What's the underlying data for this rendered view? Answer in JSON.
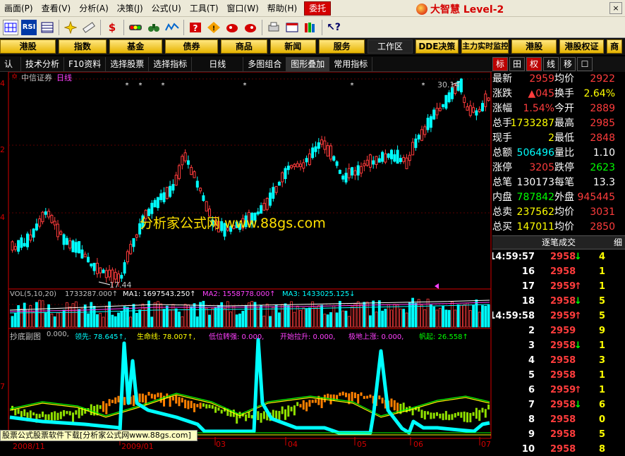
{
  "menubar": {
    "items": [
      "画面(P)",
      "查看(V)",
      "分析(A)",
      "决策(J)",
      "公式(U)",
      "工具(T)",
      "窗口(W)",
      "帮助(H)"
    ],
    "highlight": "委托",
    "brand": "大智慧 Level-2",
    "close": "×"
  },
  "toolbar": {
    "buttons": [
      "rsi",
      "grid",
      "cross",
      "ruler",
      "dollar",
      "traffic-light",
      "binocular",
      "wave",
      "question",
      "signal",
      "flame",
      "target",
      "print",
      "card",
      "books",
      "help-arrow"
    ]
  },
  "quickbar": {
    "left": [
      "港股",
      "指数",
      "基金",
      "债券",
      "商品",
      "新闻",
      "服务"
    ],
    "workspace": "工作区",
    "right": [
      "DDE决策",
      "主力实时监控",
      "港股",
      "港股权证",
      "商"
    ]
  },
  "subbar": {
    "items": [
      "认",
      "技术分析",
      "F10资料",
      "选择股票",
      "选择指标",
      "日线",
      "多图组合",
      "图形叠加",
      "常用指标"
    ]
  },
  "chart": {
    "stock": "中信证券",
    "period": "日线",
    "watermark": "分析家公式网 www.88gs.com",
    "low_label": "17.44",
    "high_label": "30.14",
    "price_axis": [
      "4",
      "2",
      "4"
    ],
    "vol_label": "VOL(5,10,20)",
    "vol_value": "1733287.000↑",
    "ma1": "MA1: 1697543.250↑",
    "ma2": "MA2: 1558778.000↑",
    "ma3": "MA3: 1433025.125↓",
    "ind_title": "抄底副图",
    "ind_val": "0.000,",
    "ind_lead": "领先: 78.645↑,",
    "ind_life": "生命线: 78.007↑,",
    "ind_low": "低位转强: 0.000,",
    "ind_pull": "开始拉升: 0.000,",
    "ind_bottom": "极地上涨: 0.000,",
    "ind_sail": "帆起: 26.558↑",
    "ind_axis": "7",
    "dates": [
      "2008/11",
      "2009/01",
      "03",
      "04",
      "05",
      "06",
      "07"
    ],
    "bottom_note": "股票公式股票软件下载[分析家公式网www.88gs.com]"
  },
  "right_tabs": [
    "标",
    "田",
    "权",
    "线",
    "移",
    "☐"
  ],
  "quote": {
    "rows": [
      {
        "l1": "最新",
        "v1": "2959",
        "l2": "均价",
        "v2": "2922",
        "c1": "#ff3c3c",
        "c2": "#ff3c3c"
      },
      {
        "l1": "涨跌",
        "v1": "▲045",
        "l2": "换手",
        "v2": "2.64%",
        "c1": "#ff3c3c",
        "c2": "#ffff00"
      },
      {
        "l1": "涨幅",
        "v1": "1.54%",
        "l2": "今开",
        "v2": "2889",
        "c1": "#ff3c3c",
        "c2": "#ff3c3c"
      },
      {
        "l1": "总手",
        "v1": "1733287",
        "l2": "最高",
        "v2": "2985",
        "c1": "#ffff00",
        "c2": "#ff3c3c"
      },
      {
        "l1": "现手",
        "v1": "2",
        "l2": "最低",
        "v2": "2848",
        "c1": "#ffff00",
        "c2": "#ff3c3c"
      },
      {
        "l1": "总额",
        "v1": "506496",
        "l2": "量比",
        "v2": "1.10",
        "c1": "#00ffff",
        "c2": "#ffffff"
      },
      {
        "l1": "涨停",
        "v1": "3205",
        "l2": "跌停",
        "v2": "2623",
        "c1": "#ff3c3c",
        "c2": "#00ff00"
      },
      {
        "l1": "总笔",
        "v1": "130173",
        "l2": "每笔",
        "v2": "13.3",
        "c1": "#ffffff",
        "c2": "#ffffff"
      },
      {
        "l1": "内盘",
        "v1": "787842",
        "l2": "外盘",
        "v2": "945445",
        "c1": "#00ff00",
        "c2": "#ff3c3c"
      },
      {
        "l1": "总卖",
        "v1": "237562",
        "l2": "均价",
        "v2": "3031",
        "c1": "#ffff00",
        "c2": "#ff3c3c"
      },
      {
        "l1": "总买",
        "v1": "147011",
        "l2": "均价",
        "v2": "2850",
        "c1": "#ffff00",
        "c2": "#ff3c3c"
      }
    ]
  },
  "ticks": {
    "title": "逐笔成交",
    "side": "细",
    "rows": [
      {
        "t": "14:59:57",
        "p": "2958",
        "d": "down",
        "v": "4"
      },
      {
        "t": "16",
        "p": "2958",
        "d": "",
        "v": "1"
      },
      {
        "t": "17",
        "p": "2959",
        "d": "up",
        "v": "1"
      },
      {
        "t": "18",
        "p": "2958",
        "d": "down",
        "v": "5"
      },
      {
        "t": "14:59:58",
        "p": "2959",
        "d": "up",
        "v": "5"
      },
      {
        "t": "2",
        "p": "2959",
        "d": "",
        "v": "9"
      },
      {
        "t": "3",
        "p": "2958",
        "d": "down",
        "v": "1"
      },
      {
        "t": "4",
        "p": "2958",
        "d": "",
        "v": "3"
      },
      {
        "t": "5",
        "p": "2958",
        "d": "",
        "v": "1"
      },
      {
        "t": "6",
        "p": "2959",
        "d": "up",
        "v": "1"
      },
      {
        "t": "7",
        "p": "2958",
        "d": "down",
        "v": "6"
      },
      {
        "t": "8",
        "p": "2958",
        "d": "",
        "v": "0"
      },
      {
        "t": "9",
        "p": "2958",
        "d": "",
        "v": "5"
      },
      {
        "t": "10",
        "p": "2958",
        "d": "",
        "v": "8"
      }
    ]
  }
}
